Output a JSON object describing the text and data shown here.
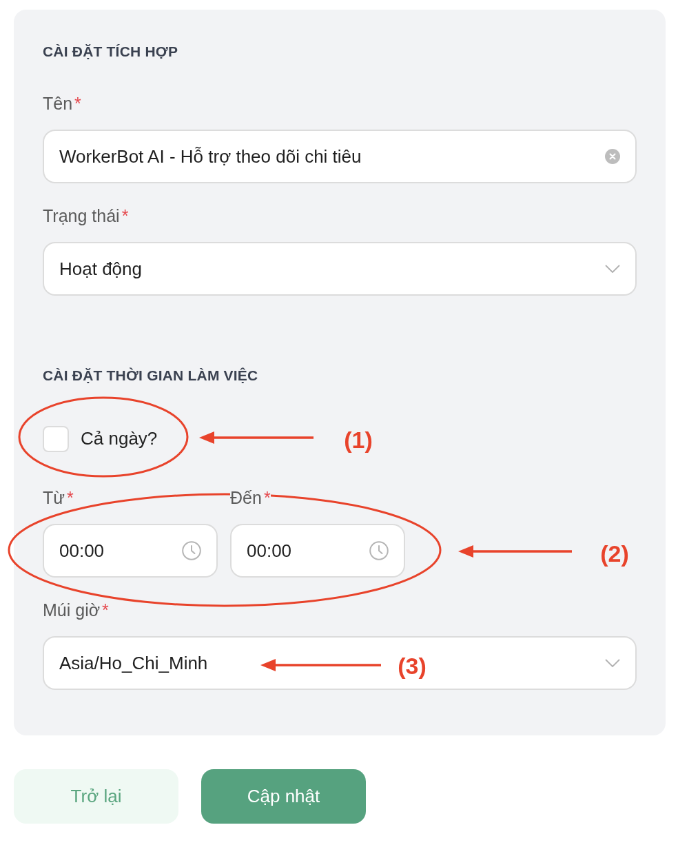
{
  "sections": [
    {
      "title": "CÀI ĐẶT TÍCH HỢP",
      "fields": [
        {
          "kind": "text",
          "label": "Tên",
          "required_mark": "*",
          "value": "WorkerBot AI - Hỗ trợ theo dõi chi tiêu",
          "clearable": true
        },
        {
          "kind": "select",
          "label": "Trạng thái",
          "required_mark": "*",
          "value": "Hoạt động"
        }
      ]
    },
    {
      "title": "CÀI ĐẶT THỜI GIAN LÀM VIỆC",
      "fields": [
        {
          "kind": "checkbox",
          "label": "Cả ngày?",
          "checked": false
        },
        {
          "kind": "time_pair",
          "items": [
            {
              "label": "Từ",
              "required_mark": "*",
              "value": "00:00"
            },
            {
              "label": "Đến",
              "required_mark": "*",
              "value": "00:00"
            }
          ]
        },
        {
          "kind": "select",
          "label": "Múi giờ",
          "required_mark": "*",
          "value": "Asia/Ho_Chi_Minh"
        }
      ]
    }
  ],
  "buttons": [
    {
      "kind": "secondary",
      "label": "Trở lại"
    },
    {
      "kind": "primary",
      "label": "Cập nhật"
    }
  ],
  "annotations": [
    {
      "label": "(1)",
      "circled": true
    },
    {
      "label": "(2)",
      "circled": true
    },
    {
      "label": "(3)",
      "circled": false
    }
  ]
}
